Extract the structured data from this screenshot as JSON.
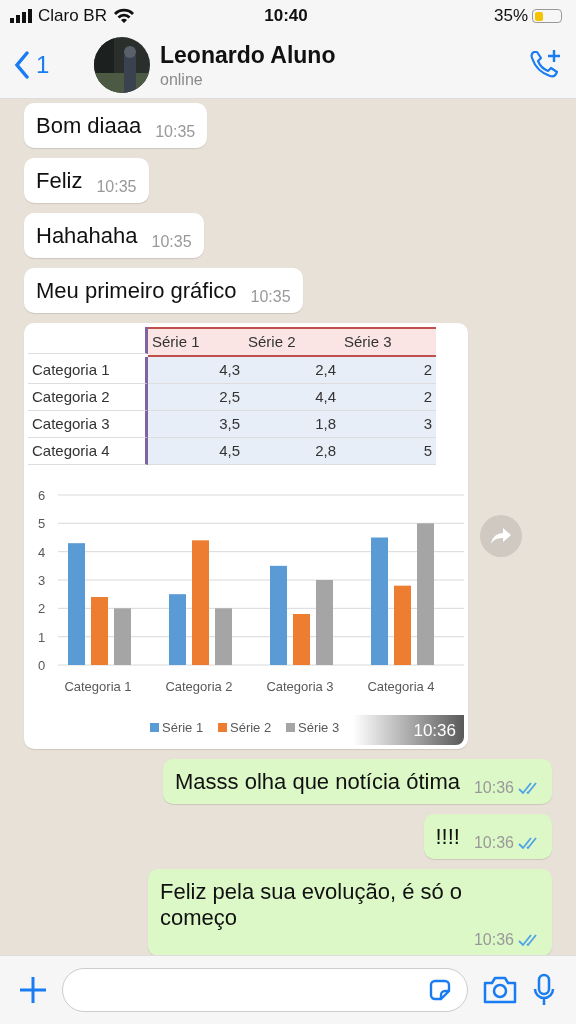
{
  "status_bar": {
    "carrier": "Claro BR",
    "time": "10:40",
    "battery": "35%"
  },
  "header": {
    "back_count": "1",
    "name": "Leonardo Aluno",
    "status": "online"
  },
  "messages": [
    {
      "kind": "text",
      "outgoing": false,
      "text": "Bom diaaa",
      "time": "10:35"
    },
    {
      "kind": "text",
      "outgoing": false,
      "text": "Feliz",
      "time": "10:35"
    },
    {
      "kind": "text",
      "outgoing": false,
      "text": "Hahahaha",
      "time": "10:35"
    },
    {
      "kind": "text",
      "outgoing": false,
      "text": "Meu primeiro gráfico",
      "time": "10:35"
    },
    {
      "outgoing": false,
      "time": "10:36",
      "table": {
        "columns": [
          "Série 1",
          "Série 2",
          "Série 3"
        ],
        "rows": [
          {
            "label": "Categoria 1",
            "cells": [
              "4,3",
              "2,4",
              "2"
            ]
          },
          {
            "label": "Categoria 2",
            "cells": [
              "2,5",
              "4,4",
              "2"
            ]
          },
          {
            "label": "Categoria 3",
            "cells": [
              "3,5",
              "1,8",
              "3"
            ]
          },
          {
            "label": "Categoria 4",
            "cells": [
              "4,5",
              "2,8",
              "5"
            ]
          }
        ]
      },
      "chart_data": {
        "type": "bar",
        "categories": [
          "Categoria 1",
          "Categoria 2",
          "Categoria 3",
          "Categoria 4"
        ],
        "series": [
          {
            "name": "Série 1",
            "color": "#5b9bd5",
            "values": [
              4.3,
              2.5,
              3.5,
              4.5
            ]
          },
          {
            "name": "Série 2",
            "color": "#ed7d31",
            "values": [
              2.4,
              4.4,
              1.8,
              2.8
            ]
          },
          {
            "name": "Série 3",
            "color": "#a5a5a5",
            "values": [
              2,
              2,
              3,
              5
            ]
          }
        ],
        "ylim": [
          0,
          6
        ],
        "yticks": [
          0,
          1,
          2,
          3,
          4,
          5,
          6
        ],
        "grid": true,
        "legend": "bottom"
      }
    },
    {
      "kind": "text",
      "outgoing": true,
      "text": "Masss olha que notícia ótima",
      "time": "10:36",
      "read": true
    },
    {
      "kind": "text",
      "outgoing": true,
      "text": "!!!!",
      "time": "10:36",
      "read": true
    },
    {
      "kind": "text",
      "outgoing": true,
      "text": "Feliz pela sua evolução, é só o começo",
      "time": "10:36",
      "read": true
    }
  ]
}
